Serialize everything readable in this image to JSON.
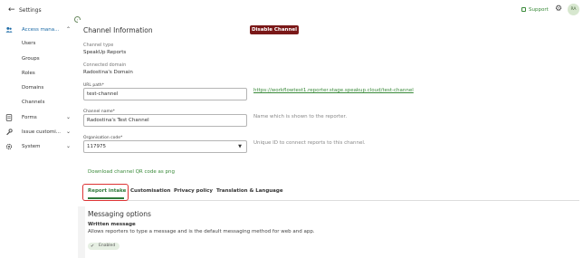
{
  "sidebar": {
    "title": "Settings",
    "items": [
      {
        "label": "Access mana...",
        "active": true
      },
      {
        "label": "Forms"
      },
      {
        "label": "Issue customi..."
      },
      {
        "label": "System"
      }
    ],
    "sub_items": [
      "Users",
      "Groups",
      "Roles",
      "Domains",
      "Channels"
    ]
  },
  "topbar": {
    "support_label": "Support",
    "avatar_initials": "RA"
  },
  "channel": {
    "title": "Channel Information",
    "disable_button": "Disable Channel",
    "type_label": "Channel type",
    "type_value": "SpeakUp Reports",
    "domain_label": "Connected domain",
    "domain_value": "Radostina's Domain",
    "url_label": "URL path*",
    "url_value": "test-channel",
    "url_link": "https://workflowtest1.reporter.stage.speakup.cloud/test-channel",
    "name_label": "Channel name*",
    "name_value": "Radostina's Test Channel",
    "name_hint": "Name which is shown to the reporter.",
    "org_label": "Organisation code*",
    "org_value": "117975",
    "org_hint": "Unique ID to connect reports to this channel.",
    "qr_link": "Download channel QR code as png"
  },
  "tabs": [
    "Report intake",
    "Customisation",
    "Privacy policy",
    "Translation & Language"
  ],
  "messaging": {
    "title": "Messaging options",
    "written_title": "Written message",
    "written_desc": "Allows reporters to type a message and is the default messaging method for web and app.",
    "status_chip": "Enabled"
  },
  "colors": {
    "accent": "#2e7a3a",
    "danger": "#7a1818",
    "link": "#3a8a3a"
  }
}
